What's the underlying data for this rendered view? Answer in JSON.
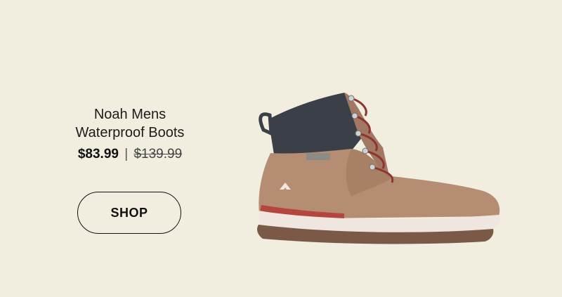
{
  "product": {
    "name_line1": "Noah Mens",
    "name_line2": "Waterproof Boots",
    "sale_price": "$83.99",
    "separator": "|",
    "original_price": "$139.99",
    "image_icon": "hiking-boot-image",
    "colors": {
      "background": "#f1eddf",
      "suede": "#b58d72",
      "collar": "#3b4048",
      "laces": "#8f3431",
      "sole": "#7a5a46",
      "midsole": "#efe7df",
      "accent_stripe": "#b5453f"
    }
  },
  "cta": {
    "shop_label": "SHOP"
  }
}
